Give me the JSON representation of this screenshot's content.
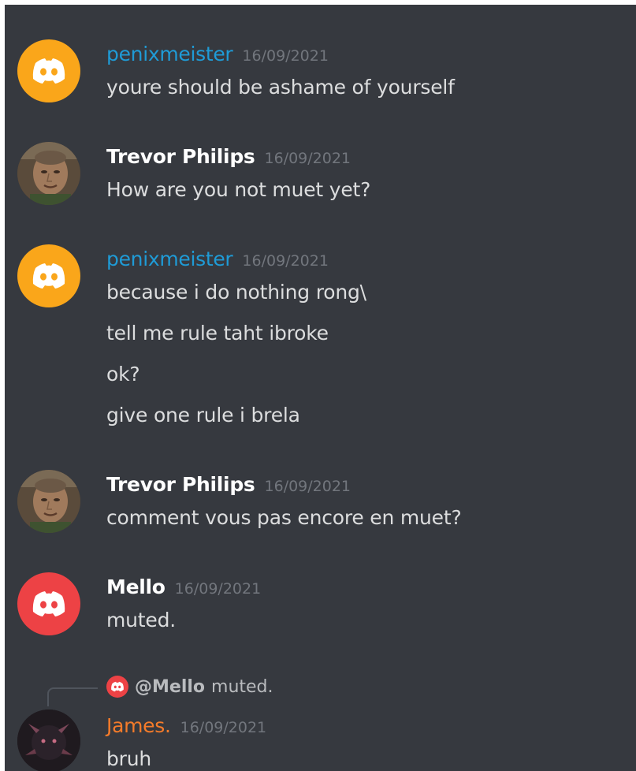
{
  "colors": {
    "background": "#36393f",
    "message_text": "#dcddde",
    "timestamp": "#72767d",
    "penix_name": "#1f9bd6",
    "trevor_name": "#ffffff",
    "mello_name": "#ffffff",
    "james_name": "#f47b2a",
    "avatar_orange": "#faa61a",
    "avatar_red": "#ed4245"
  },
  "messages": [
    {
      "author": "penixmeister",
      "timestamp": "16/09/2021",
      "avatar": "discord-logo-orange-icon",
      "lines": [
        "youre should be ashame of yourself"
      ]
    },
    {
      "author": "Trevor Philips",
      "timestamp": "16/09/2021",
      "avatar": "trevor-photo-avatar",
      "lines": [
        "How are you not muet yet?"
      ]
    },
    {
      "author": "penixmeister",
      "timestamp": "16/09/2021",
      "avatar": "discord-logo-orange-icon",
      "lines": [
        "because i do nothing rong\\",
        "tell me rule taht ibroke",
        "ok?",
        "give one rule i brela"
      ]
    },
    {
      "author": "Trevor Philips",
      "timestamp": "16/09/2021",
      "avatar": "trevor-photo-avatar",
      "lines": [
        "comment vous pas encore en muet?"
      ]
    },
    {
      "author": "Mello",
      "timestamp": "16/09/2021",
      "avatar": "discord-logo-red-icon",
      "lines": [
        "muted."
      ]
    },
    {
      "author": "James.",
      "timestamp": "16/09/2021",
      "avatar": "dark-creature-avatar",
      "reply": {
        "author": "@Mello",
        "text": "muted."
      },
      "lines": [
        "bruh"
      ]
    }
  ]
}
